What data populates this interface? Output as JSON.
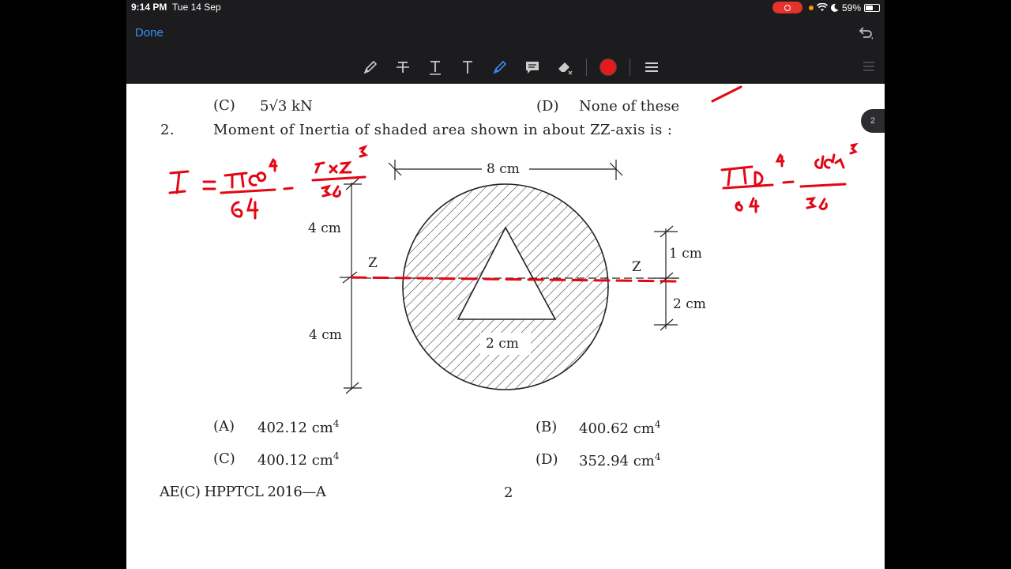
{
  "status": {
    "time": "9:14 PM",
    "date": "Tue 14 Sep",
    "battery": "59%",
    "battery_level": 0.59
  },
  "nav": {
    "done_label": "Done"
  },
  "toolbar": {
    "tools": [
      "pencil-icon",
      "strikethrough-icon",
      "text-icon",
      "text-bold-icon",
      "highlighter-icon",
      "comment-icon",
      "eraser-icon"
    ],
    "active_color": "#e31b1b"
  },
  "page_indicator": "2",
  "prev_option": {
    "c_label": "(C)",
    "c_value": "5√3 kN",
    "d_label": "(D)",
    "d_value": "None of these"
  },
  "question": {
    "number": "2.",
    "text": "Moment of Inertia of shaded area shown in about ZZ-axis is :"
  },
  "figure": {
    "width_label": "8 cm",
    "top_label": "4 cm",
    "bottom_label": "4 cm",
    "z_left": "Z",
    "z_right": "Z",
    "right_top": "1 cm",
    "right_bottom": "2 cm",
    "base_label": "2 cm"
  },
  "options": [
    {
      "label": "(A)",
      "value": "402.12 cm",
      "sup": "4"
    },
    {
      "label": "(B)",
      "value": "400.62 cm",
      "sup": "4"
    },
    {
      "label": "(C)",
      "value": "400.12 cm",
      "sup": "4"
    },
    {
      "label": "(D)",
      "value": "352.94 cm",
      "sup": "4"
    }
  ],
  "footer": {
    "code": "AE(C) HPPTCL 2016—A",
    "page": "2"
  },
  "annotation_color": "#e30613"
}
